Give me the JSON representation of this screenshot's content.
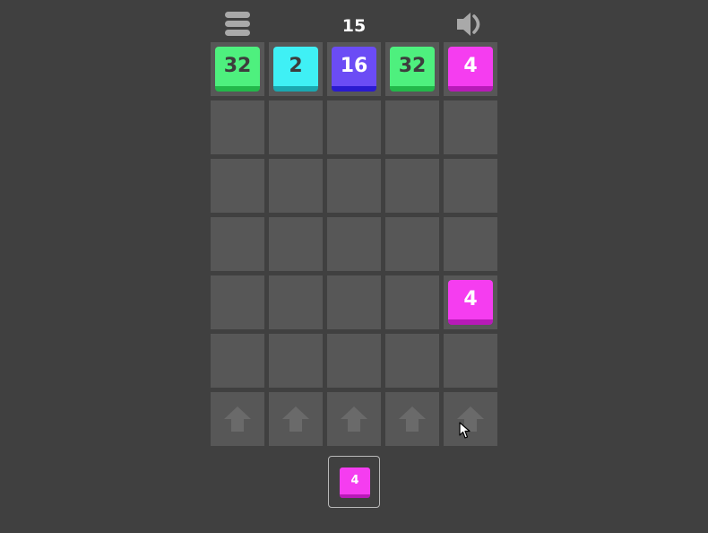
{
  "header": {
    "score": "15",
    "menu_icon": "menu-icon",
    "sound_icon": "speaker-icon"
  },
  "board": {
    "columns": 5,
    "rows": 6,
    "tiles": [
      {
        "row": 0,
        "col": 0,
        "value": "32",
        "color": "#4ef07e",
        "shade": "#22b84a",
        "text_color": "#3d3d3d"
      },
      {
        "row": 0,
        "col": 1,
        "value": "2",
        "color": "#3ff0f5",
        "shade": "#1aa8b0",
        "text_color": "#3d3d3d"
      },
      {
        "row": 0,
        "col": 2,
        "value": "16",
        "color": "#6b4cf5",
        "shade": "#2a1ad0",
        "text_color": "#ffffff"
      },
      {
        "row": 0,
        "col": 3,
        "value": "32",
        "color": "#4ef07e",
        "shade": "#22b84a",
        "text_color": "#3d3d3d"
      },
      {
        "row": 0,
        "col": 4,
        "value": "4",
        "color": "#f53df0",
        "shade": "#b81ab8",
        "text_color": "#ffffff"
      },
      {
        "row": 4,
        "col": 4,
        "value": "4",
        "color": "#f53df0",
        "shade": "#b81ab8",
        "text_color": "#ffffff"
      }
    ],
    "drop_arrow_icon": "up-arrow-icon"
  },
  "next_tile": {
    "value": "4",
    "color": "#f53df0",
    "shade": "#b81ab8"
  },
  "colors": {
    "background": "#404040",
    "cell": "#575757",
    "arrow": "#6a6a6a",
    "icon": "#a9a9a9"
  }
}
